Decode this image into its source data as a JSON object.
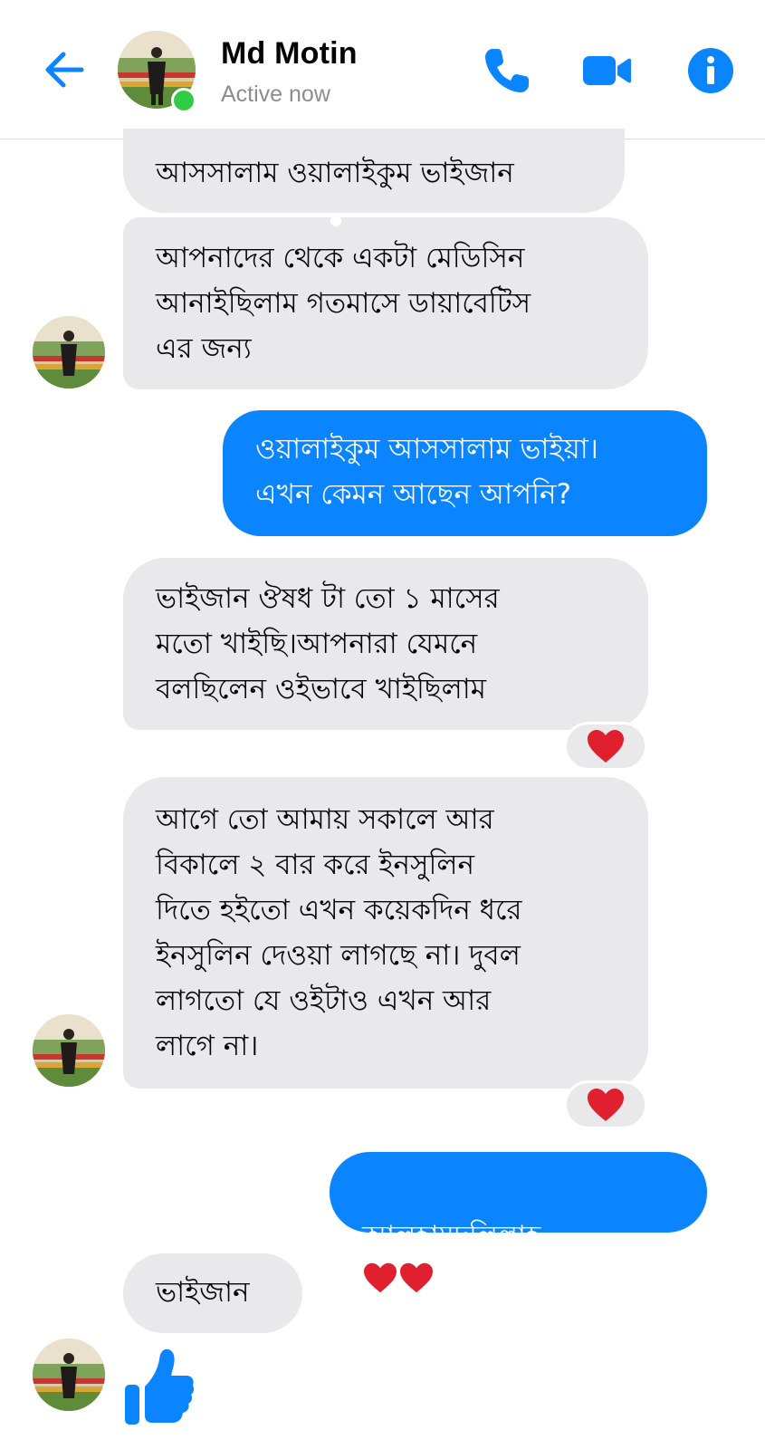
{
  "header": {
    "contact_name": "Md Motin",
    "status": "Active now",
    "accent_color": "#0a84ff",
    "icons": [
      "back-arrow-icon",
      "phone-icon",
      "video-call-icon",
      "info-icon"
    ]
  },
  "messages": [
    {
      "direction": "incoming",
      "text": "আসসালাম ওয়ালাইকুম ভাইজান"
    },
    {
      "direction": "incoming",
      "text": "আপনাদের থেকে একটা মেডিসিন\nআনাইছিলাম গতমাসে ডায়াবেটিস\nএর জন্য"
    },
    {
      "direction": "outgoing",
      "text": "ওয়ালাইকুম আসসালাম ভাইয়া।\nএখন কেমন আছেন আপনি?"
    },
    {
      "direction": "incoming",
      "text": "ভাইজান ঔষধ টা তো ১ মাসের\nমতো খাইছি।আপনারা যেমনে\nবলছিলেন ওইভাবে খাইছিলাম",
      "reaction": "heart"
    },
    {
      "direction": "incoming",
      "text": "আগে তো আমায় সকালে আর\nবিকালে ২ বার করে ইনসুলিন\nদিতে হইতো এখন কয়েকদিন ধরে\nইনসুলিন দেওয়া লাগছে না। দুবল\nলাগতো যে ওইটাও এখন আর\nলাগে না।",
      "reaction": "heart"
    },
    {
      "direction": "outgoing",
      "text": "আলহামদুলিল্লাহ",
      "emoji": "two-hearts"
    },
    {
      "direction": "incoming",
      "text": "ভাইজান"
    },
    {
      "direction": "incoming",
      "sticker": "thumbs-up-icon"
    }
  ],
  "colors": {
    "incoming_bubble": "#e9e9eb",
    "outgoing_bubble": "#0a84ff",
    "heart": "#e0202e",
    "active_dot": "#31cc46"
  }
}
